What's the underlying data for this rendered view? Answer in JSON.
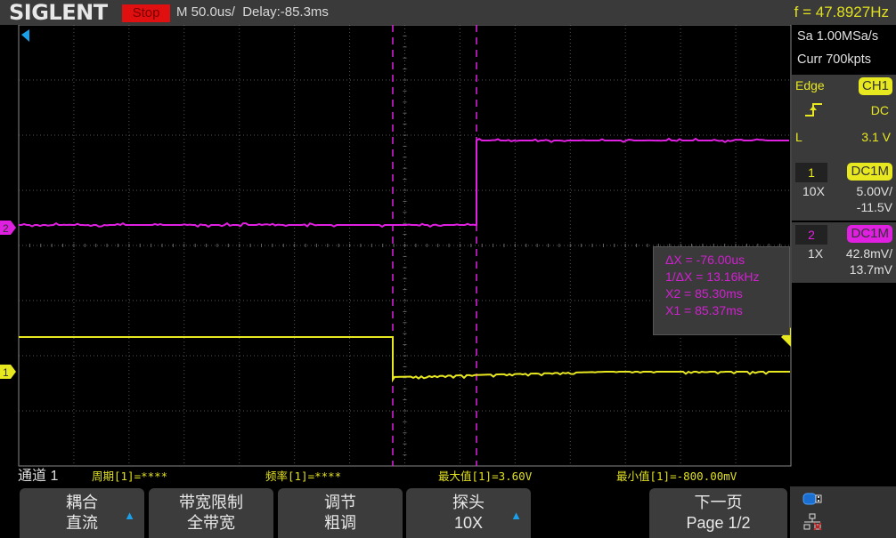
{
  "topbar": {
    "logo": "SIGLENT",
    "run_state": "Stop",
    "timebase": "M 50.0us/",
    "delay": "Delay:-85.3ms",
    "frequency": "f = 47.8927Hz"
  },
  "acquisition": {
    "sample_rate": "Sa 1.00MSa/s",
    "memory_depth": "Curr 700kpts"
  },
  "trigger": {
    "type": "Edge",
    "source": "CH1",
    "slope_icon": "rising-edge-icon",
    "coupling": "DC",
    "level_label": "L",
    "level": "3.1 V"
  },
  "channels": [
    {
      "number": "1",
      "coupling": "DC1M",
      "probe": "10X",
      "scale": "5.00V/",
      "offset": "-11.5V",
      "color": "#e8e820"
    },
    {
      "number": "2",
      "coupling": "DC1M",
      "probe": "1X",
      "scale": "42.8mV/",
      "offset": "13.7mV",
      "color": "#e020e0"
    }
  ],
  "cursors": {
    "delta_x": "ΔX = -76.00us",
    "inv_delta_x": "1/ΔX = 13.16kHz",
    "x2": "X2 = 85.30ms",
    "x1": "X1 = 85.37ms"
  },
  "measurements": {
    "channel_label": "通道 1",
    "items": [
      "周期[1]=****",
      "频率[1]=****",
      "最大值[1]=3.60V",
      "最小值[1]=-800.00mV"
    ]
  },
  "softkeys": [
    {
      "title": "耦合",
      "value": "直流",
      "has_arrow": true
    },
    {
      "title": "带宽限制",
      "value": "全带宽",
      "has_arrow": false
    },
    {
      "title": "调节",
      "value": "粗调",
      "has_arrow": false
    },
    {
      "title": "探头",
      "value": "10X",
      "has_arrow": true
    },
    {
      "title": "下一页",
      "value": "Page 1/2",
      "has_arrow": false
    }
  ],
  "status_icons": [
    "usb-icon",
    "network-disconnected-icon"
  ],
  "markers": {
    "ch1": "1",
    "ch2": "2"
  },
  "colors": {
    "ch1": "#e8e820",
    "ch2": "#e020e0",
    "stop": "#e01010",
    "trigger_pos": "#1aa0e8"
  }
}
